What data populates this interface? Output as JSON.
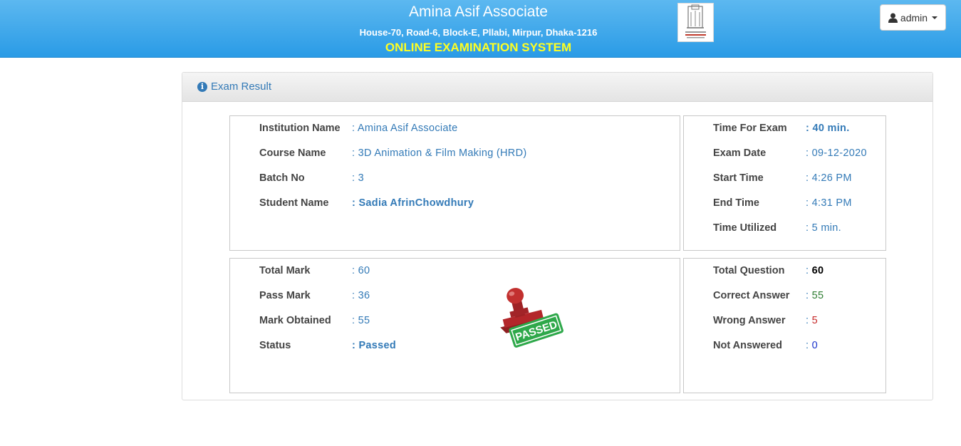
{
  "header": {
    "title": "Amina Asif Associate",
    "address": "House-70, Road-6, Block-E, Pllabi, Mirpur, Dhaka-1216",
    "system_name": "ONLINE EXAMINATION SYSTEM",
    "user_label": "admin"
  },
  "panel": {
    "title": "Exam Result"
  },
  "info": {
    "institution_label": "Institution Name",
    "institution_value": ": Amina Asif Associate",
    "course_label": "Course Name",
    "course_value": ": 3D Animation & Film Making (HRD)",
    "batch_label": "Batch No",
    "batch_value": ": 3",
    "student_label": "Student Name",
    "student_value": ": Sadia AfrinChowdhury"
  },
  "time": {
    "time_for_exam_label": "Time For Exam",
    "time_for_exam_value": ": 40 min.",
    "exam_date_label": "Exam Date",
    "exam_date_value": ": 09-12-2020",
    "start_time_label": "Start Time",
    "start_time_value": ": 4:26 PM",
    "end_time_label": "End Time",
    "end_time_value": ": 4:31 PM",
    "time_utilized_label": "Time Utilized",
    "time_utilized_value": ": 5 min."
  },
  "marks": {
    "total_label": "Total Mark",
    "total_value": ": 60",
    "pass_label": "Pass Mark",
    "pass_value": ": 36",
    "obtained_label": "Mark Obtained",
    "obtained_value": ": 55",
    "status_label": "Status",
    "status_value": ": Passed",
    "stamp_text": "PASSED"
  },
  "questions": {
    "total_label": "Total Question",
    "total_prefix": ": ",
    "total_value": "60",
    "correct_label": "Correct Answer",
    "correct_prefix": ": ",
    "correct_value": "55",
    "wrong_label": "Wrong Answer",
    "wrong_prefix": ": ",
    "wrong_value": "5",
    "not_answered_label": "Not Answered",
    "not_answered_prefix": ": ",
    "not_answered_value": "0"
  },
  "colors": {
    "header_blue": "#2a9be6",
    "link_blue": "#337ab7",
    "system_yellow": "#ffff22",
    "correct_green": "#2e7d32",
    "wrong_red": "#c62828",
    "not_answered_blue": "#1a33cc",
    "stamp_red": "#b3262a",
    "stamp_green": "#2ea84a"
  }
}
